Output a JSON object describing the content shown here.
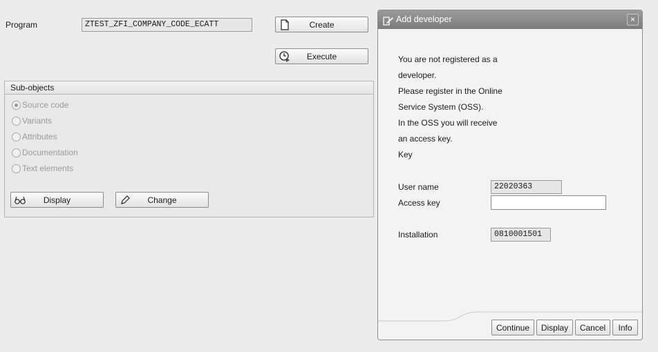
{
  "main": {
    "program_label": "Program",
    "program_value": "ZTEST_ZFI_COMPANY_CODE_ECATT",
    "create_label": "Create",
    "execute_label": "Execute",
    "subobjects": {
      "title": "Sub-objects",
      "options": [
        {
          "label": "Source code",
          "selected": true
        },
        {
          "label": "Variants",
          "selected": false
        },
        {
          "label": "Attributes",
          "selected": false
        },
        {
          "label": "Documentation",
          "selected": false
        },
        {
          "label": "Text elements",
          "selected": false
        }
      ],
      "display_label": "Display",
      "change_label": "Change"
    }
  },
  "dialog": {
    "title": "Add developer",
    "close_glyph": "×",
    "message_lines": [
      "You are not registered as a",
      "developer.",
      "Please register in the Online",
      "Service System (OSS).",
      "In the OSS you will receive",
      "an access key.",
      "Key"
    ],
    "user_name_label": "User name",
    "user_name_value": "22020363",
    "access_key_label": "Access key",
    "access_key_value": "",
    "installation_label": "Installation",
    "installation_value": "0810001501",
    "buttons": {
      "continue": "Continue",
      "display": "Display",
      "cancel": "Cancel",
      "info": "Info"
    }
  },
  "colors": {
    "background": "#ececec",
    "dialog_title_bar": "#8a8a8a",
    "disabled_text": "#9a9a9a"
  },
  "icons": {
    "create": "blank-document-icon",
    "execute": "execute-clock-icon",
    "display": "glasses-icon",
    "change": "pencil-icon",
    "dialog": "edit-document-icon",
    "close": "close-icon"
  }
}
